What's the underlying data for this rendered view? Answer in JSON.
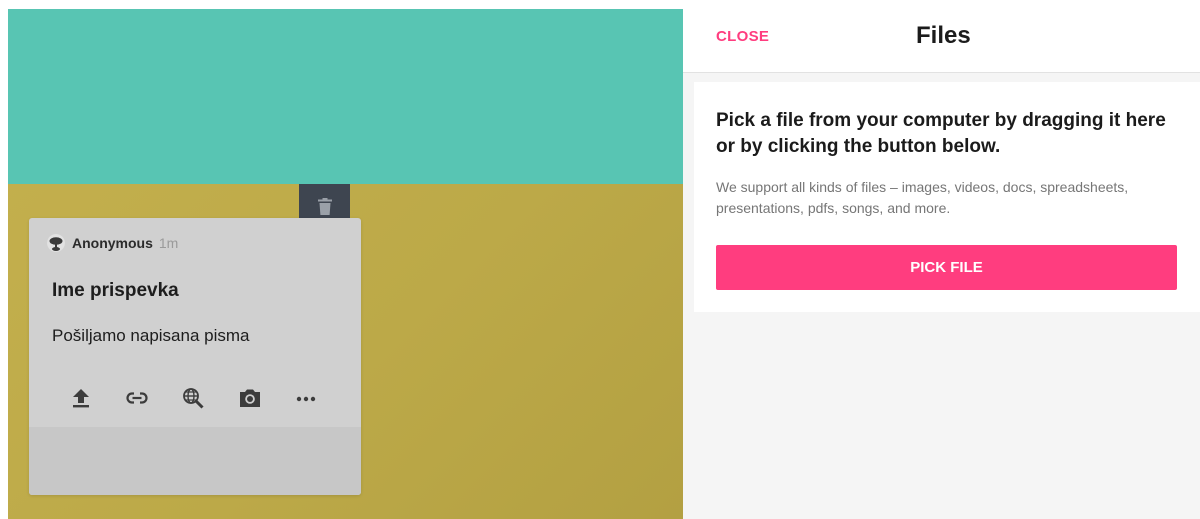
{
  "board": {
    "top_color": "#58c5b3",
    "bottom_color": "#c0ad4b"
  },
  "card": {
    "author": "Anonymous",
    "time": "1m",
    "title": "Ime prispevka",
    "body": "Pošiljamo napisana pisma",
    "tools": [
      {
        "name": "upload-icon"
      },
      {
        "name": "link-icon"
      },
      {
        "name": "web-search-icon"
      },
      {
        "name": "camera-icon"
      },
      {
        "name": "more-icon"
      }
    ],
    "delete_icon": "trash-icon"
  },
  "panel": {
    "close_label": "CLOSE",
    "title": "Files",
    "heading": "Pick a file from your computer by dragging it here or by clicking the button below.",
    "description": "We support all kinds of files – images, videos, docs, spreadsheets, presentations, pdfs, songs, and more.",
    "pick_label": "PICK FILE",
    "accent_color": "#ff3d7f"
  }
}
